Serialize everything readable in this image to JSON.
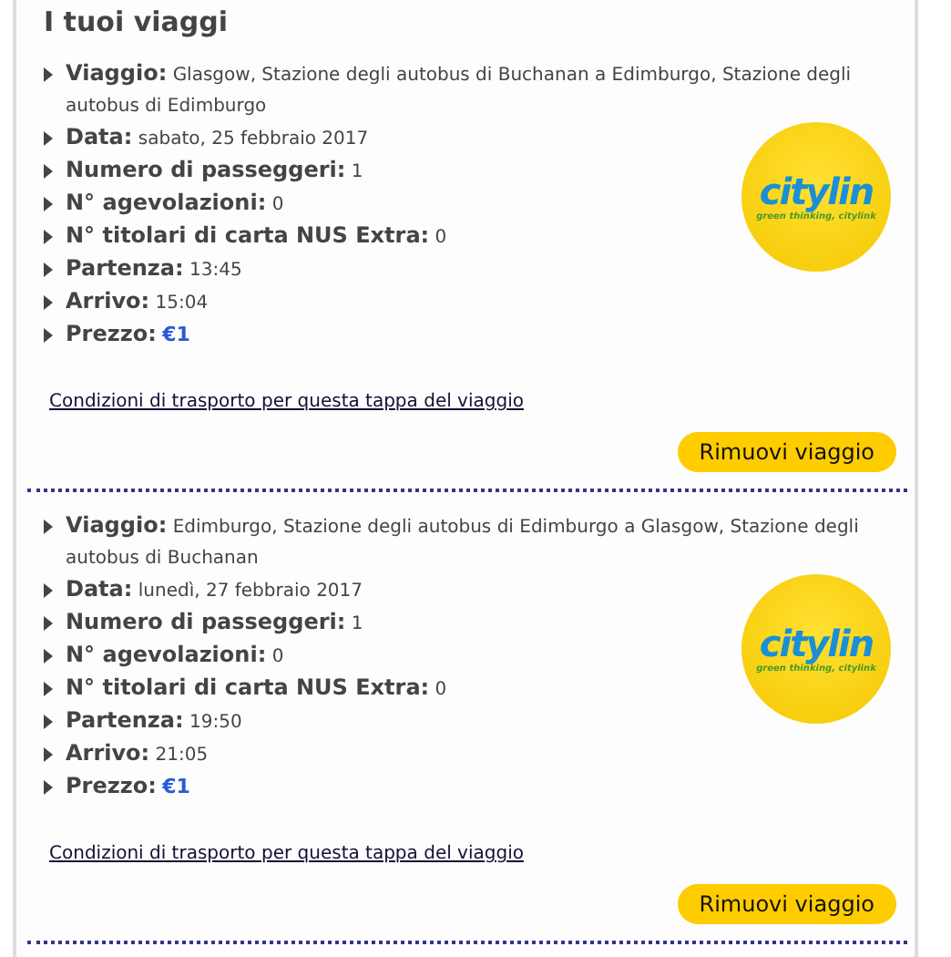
{
  "title": "I tuoi viaggi",
  "trips": [
    {
      "fields": [
        {
          "kind": "text",
          "label": "Viaggio:",
          "value": "Glasgow, Stazione degli autobus di Buchanan a Edimburgo, Stazione degli autobus di Edimburgo"
        },
        {
          "kind": "text",
          "label": "Data:",
          "value": "sabato, 25 febbraio 2017"
        },
        {
          "kind": "text",
          "label": "Numero di passeggeri:",
          "value": "1"
        },
        {
          "kind": "text",
          "label": "N° agevolazioni:",
          "value": "0"
        },
        {
          "kind": "text",
          "label": "N° titolari di carta NUS Extra:",
          "value": "0"
        },
        {
          "kind": "text",
          "label": "Partenza:",
          "value": "13:45"
        },
        {
          "kind": "text",
          "label": "Arrivo:",
          "value": "15:04"
        },
        {
          "kind": "price",
          "label": "Prezzo:",
          "value": "€1"
        }
      ],
      "logo": {
        "name": "citylin",
        "tagline": "green thinking, citylink"
      },
      "link": "Condizioni di trasporto per questa tappa del viaggio",
      "button": "Rimuovi viaggio"
    },
    {
      "fields": [
        {
          "kind": "text",
          "label": "Viaggio:",
          "value": "Edimburgo, Stazione degli autobus di Edimburgo a Glasgow, Stazione degli autobus di Buchanan"
        },
        {
          "kind": "text",
          "label": "Data:",
          "value": "lunedì, 27 febbraio 2017"
        },
        {
          "kind": "text",
          "label": "Numero di passeggeri:",
          "value": "1"
        },
        {
          "kind": "text",
          "label": "N° agevolazioni:",
          "value": "0"
        },
        {
          "kind": "text",
          "label": "N° titolari di carta NUS Extra:",
          "value": "0"
        },
        {
          "kind": "text",
          "label": "Partenza:",
          "value": "19:50"
        },
        {
          "kind": "text",
          "label": "Arrivo:",
          "value": "21:05"
        },
        {
          "kind": "price",
          "label": "Prezzo:",
          "value": "€1"
        }
      ],
      "logo": {
        "name": "citylin",
        "tagline": "green thinking, citylink"
      },
      "link": "Condizioni di trasporto per questa tappa del viaggio",
      "button": "Rimuovi viaggio"
    }
  ]
}
